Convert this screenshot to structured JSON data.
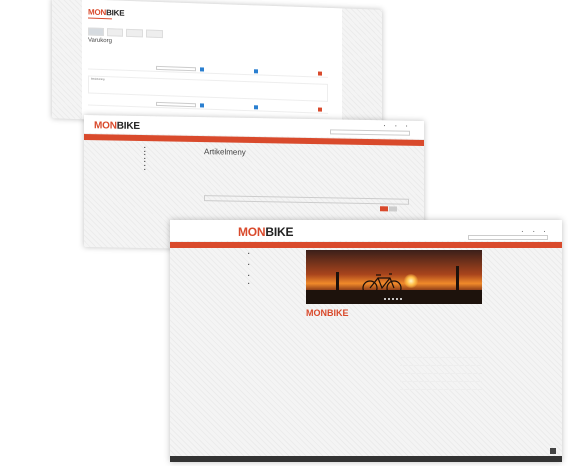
{
  "brand": {
    "mon": "MON",
    "bike": "BIKE",
    "accent": "#d94a2c"
  },
  "sheet1": {
    "page_title": "Varukorg",
    "subtitle": "Beskrivning"
  },
  "sheet2": {
    "page_title": "Artikelmeny",
    "search_placeholder": ""
  },
  "sheet3": {
    "title_mon": "MON",
    "title_bike": "BIKE"
  }
}
